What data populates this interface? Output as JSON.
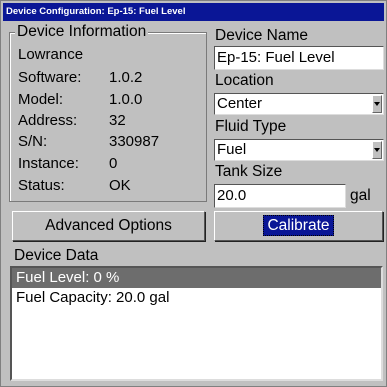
{
  "window": {
    "title": "Device Configuration: Ep-15: Fuel Level"
  },
  "device_information": {
    "title": "Device Information",
    "manufacturer": "Lowrance",
    "rows": [
      {
        "label": "Software:",
        "value": "1.0.2"
      },
      {
        "label": "Model:",
        "value": "1.0.0"
      },
      {
        "label": "Address:",
        "value": "32"
      },
      {
        "label": "S/N:",
        "value": "330987"
      },
      {
        "label": "Instance:",
        "value": "0"
      },
      {
        "label": "Status:",
        "value": "OK"
      }
    ]
  },
  "device_name": {
    "label": "Device Name",
    "value": "Ep-15: Fuel Level"
  },
  "location": {
    "label": "Location",
    "value": "Center"
  },
  "fluid_type": {
    "label": "Fluid Type",
    "value": "Fuel"
  },
  "tank_size": {
    "label": "Tank Size",
    "value": "20.0",
    "unit": "gal"
  },
  "buttons": {
    "advanced": "Advanced Options",
    "calibrate": "Calibrate"
  },
  "device_data": {
    "title": "Device Data",
    "items": [
      {
        "text": "Fuel Level: 0 %",
        "selected": true
      },
      {
        "text": "Fuel Capacity: 20.0 gal",
        "selected": false
      }
    ]
  },
  "colors": {
    "titlebar": "#0a1696",
    "selection": "#6d6d6d",
    "background": "#c0c0c0"
  }
}
